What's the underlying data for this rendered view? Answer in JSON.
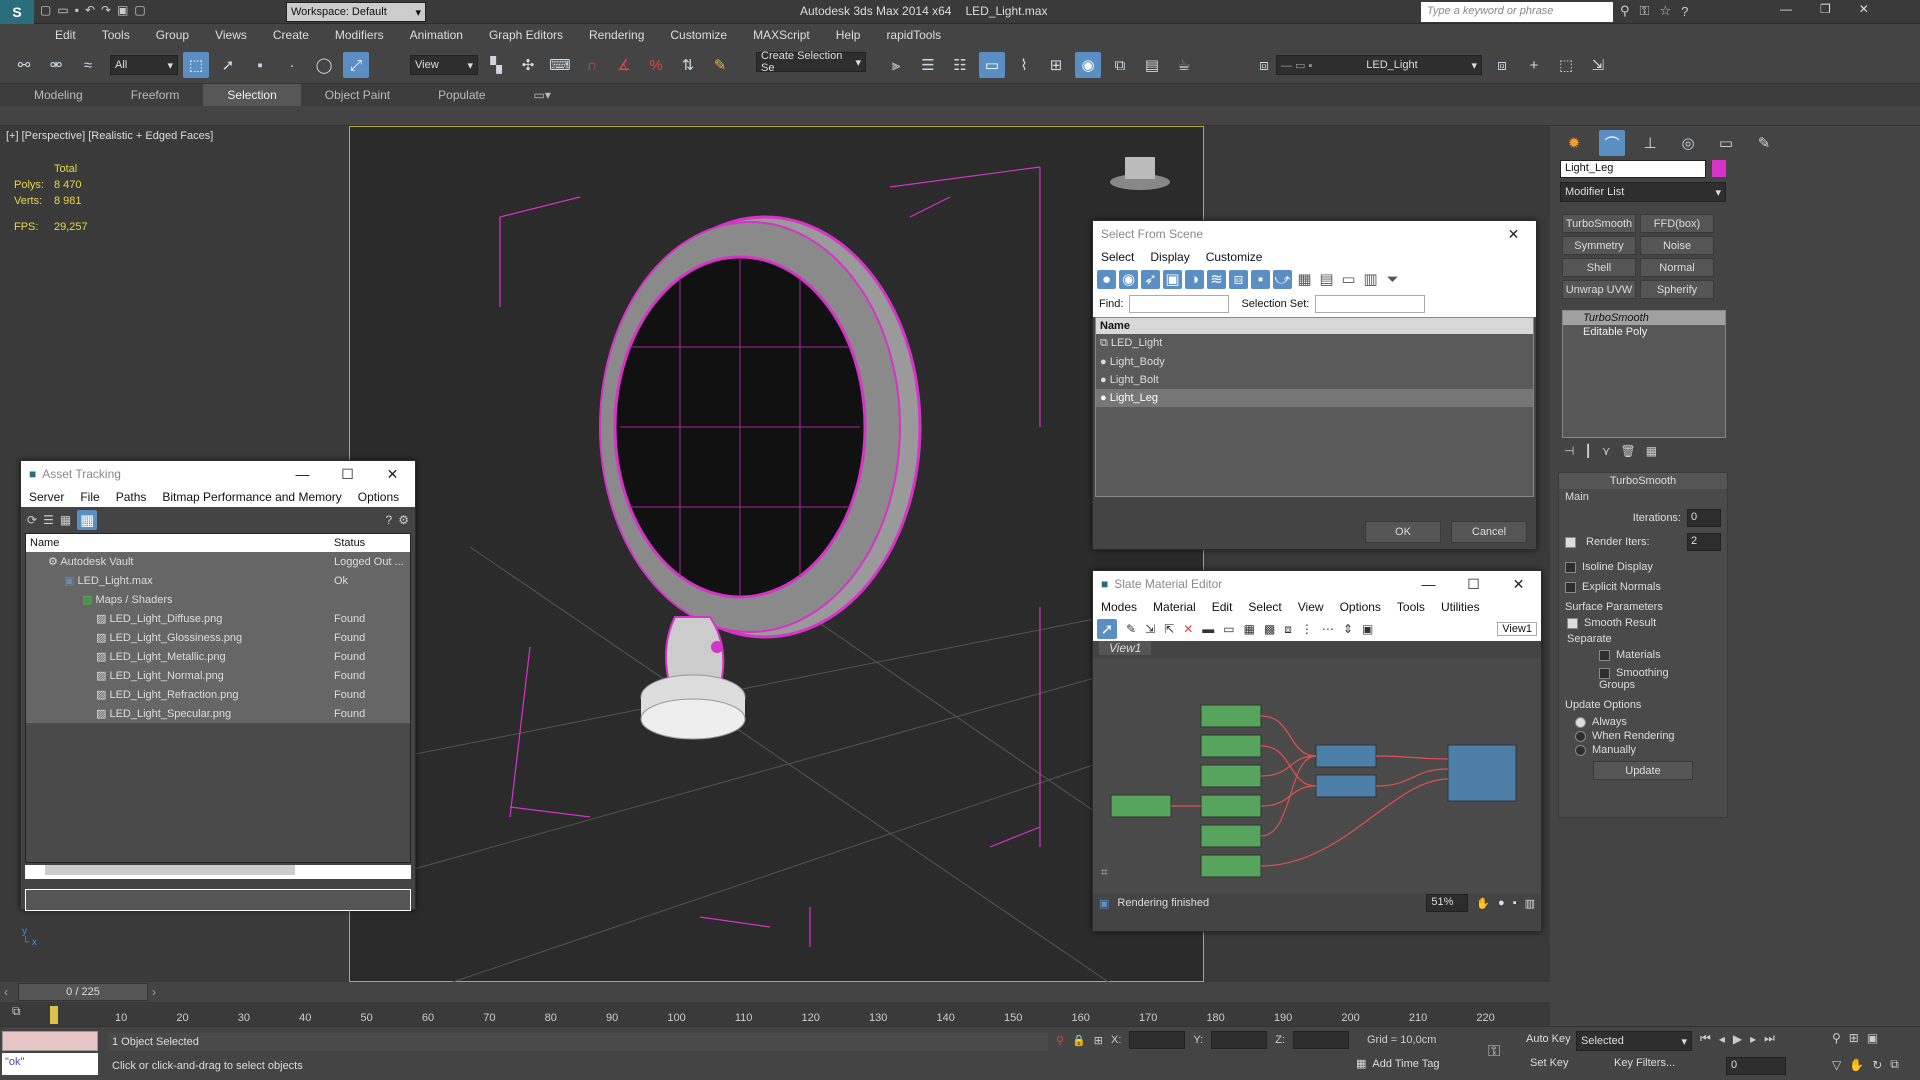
{
  "app": {
    "title": "Autodesk 3ds Max  2014 x64",
    "file": "LED_Light.max",
    "workspace": "Workspace: Default",
    "search_placeholder": "Type a keyword or phrase"
  },
  "menu": [
    "Edit",
    "Tools",
    "Group",
    "Views",
    "Create",
    "Modifiers",
    "Animation",
    "Graph Editors",
    "Rendering",
    "Customize",
    "MAXScript",
    "Help",
    "rapidTools"
  ],
  "toolbar": {
    "filter": "All",
    "refcoord": "View",
    "selection_set": "Create Selection Se",
    "layer": "LED_Light"
  },
  "ribbon_tabs": [
    "Modeling",
    "Freeform",
    "Selection",
    "Object Paint",
    "Populate"
  ],
  "viewport": {
    "label": "[+] [Perspective] [Realistic + Edged Faces]",
    "total": "Total",
    "polys_label": "Polys:",
    "polys": "8 470",
    "verts_label": "Verts:",
    "verts": "8 981",
    "fps_label": "FPS:",
    "fps": "29,257"
  },
  "command_panel": {
    "object_name": "Light_Leg",
    "modifier_list": "Modifier List",
    "modifier_buttons": [
      "TurboSmooth",
      "FFD(box)",
      "Symmetry",
      "Noise",
      "Shell",
      "Normal",
      "Unwrap UVW",
      "Spherify"
    ],
    "stack": [
      "TurboSmooth",
      "Editable Poly"
    ],
    "turbosmooth": {
      "title": "TurboSmooth",
      "main": "Main",
      "iterations_label": "Iterations:",
      "iterations": "0",
      "render_iters_label": "Render Iters:",
      "render_iters": "2",
      "isoline": "Isoline Display",
      "explicit": "Explicit Normals",
      "surface": "Surface Parameters",
      "smooth_result": "Smooth Result",
      "separate": "Separate",
      "materials": "Materials",
      "smoothing_groups": "Smoothing Groups",
      "update_options": "Update Options",
      "always": "Always",
      "when_rendering": "When Rendering",
      "manually": "Manually",
      "update": "Update"
    }
  },
  "select_from_scene": {
    "title": "Select From Scene",
    "menu": [
      "Select",
      "Display",
      "Customize"
    ],
    "find_label": "Find:",
    "selset_label": "Selection Set:",
    "col_name": "Name",
    "items": [
      "LED_Light",
      "Light_Body",
      "Light_Bolt",
      "Light_Leg"
    ],
    "ok": "OK",
    "cancel": "Cancel"
  },
  "asset_tracking": {
    "title": "Asset Tracking",
    "menu": [
      "Server",
      "File",
      "Paths",
      "Bitmap Performance and Memory",
      "Options"
    ],
    "col_name": "Name",
    "col_status": "Status",
    "rows": [
      {
        "name": "Autodesk Vault",
        "status": "Logged Out ..."
      },
      {
        "name": "LED_Light.max",
        "status": "Ok"
      },
      {
        "name": "Maps / Shaders",
        "status": ""
      },
      {
        "name": "LED_Light_Diffuse.png",
        "status": "Found"
      },
      {
        "name": "LED_Light_Glossiness.png",
        "status": "Found"
      },
      {
        "name": "LED_Light_Metallic.png",
        "status": "Found"
      },
      {
        "name": "LED_Light_Normal.png",
        "status": "Found"
      },
      {
        "name": "LED_Light_Refraction.png",
        "status": "Found"
      },
      {
        "name": "LED_Light_Specular.png",
        "status": "Found"
      }
    ]
  },
  "slate": {
    "title": "Slate Material Editor",
    "menu": [
      "Modes",
      "Material",
      "Edit",
      "Select",
      "View",
      "Options",
      "Tools",
      "Utilities"
    ],
    "view_tab": "View1",
    "view_drop": "View1",
    "status": "Rendering finished",
    "zoom": "51%"
  },
  "timeline": {
    "frame": "0 / 225",
    "ticks": [
      "10",
      "20",
      "30",
      "40",
      "50",
      "60",
      "70",
      "80",
      "90",
      "100",
      "110",
      "120",
      "130",
      "140",
      "150",
      "160",
      "170",
      "180",
      "190",
      "200",
      "210",
      "220"
    ]
  },
  "status": {
    "script": "\"ok\"",
    "selected": "1 Object Selected",
    "prompt": "Click or click-and-drag to select objects",
    "x_label": "X:",
    "y_label": "Y:",
    "z_label": "Z:",
    "grid": "Grid = 10,0cm",
    "add_time_tag": "Add Time Tag",
    "auto_key": "Auto Key",
    "set_key": "Set Key",
    "key_mode": "Selected",
    "key_filters": "Key Filters...",
    "frame_field": "0"
  },
  "colors": {
    "wire": "#d633c8",
    "accent": "#5b8fc4",
    "yellow_text": "#e8d54a"
  }
}
